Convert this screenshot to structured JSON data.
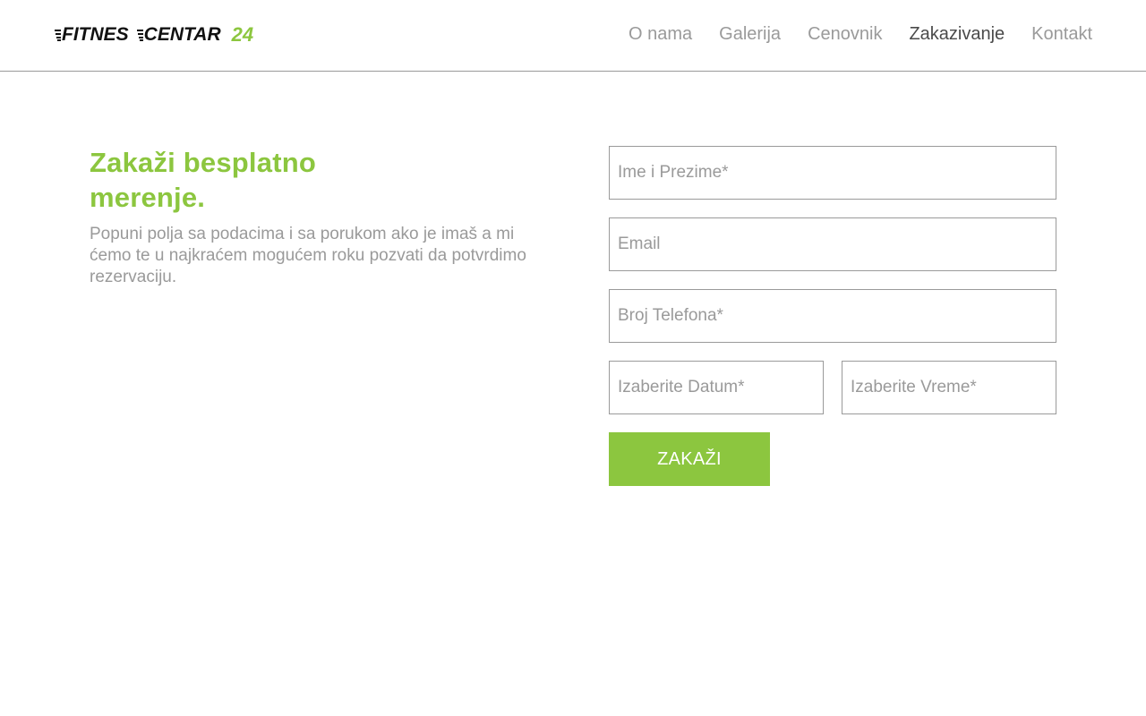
{
  "brand": {
    "word1": "FITNES",
    "word2": "CENTAR",
    "number": "24",
    "accent_color": "#8cc63f"
  },
  "nav": {
    "items": [
      {
        "label": "O nama",
        "active": false
      },
      {
        "label": "Galerija",
        "active": false
      },
      {
        "label": "Cenovnik",
        "active": false
      },
      {
        "label": "Zakazivanje",
        "active": true
      },
      {
        "label": "Kontakt",
        "active": false
      }
    ]
  },
  "intro": {
    "title": "Zakaži besplatno merenje.",
    "description": "Popuni polja sa podacima i sa porukom ako je imaš a mi ćemo te u najkraćem mogućem roku pozvati da potvrdimo rezervaciju."
  },
  "form": {
    "name": {
      "value": "",
      "placeholder": "Ime i Prezime*"
    },
    "email": {
      "value": "",
      "placeholder": "Email"
    },
    "phone": {
      "value": "",
      "placeholder": "Broj Telefona*"
    },
    "date": {
      "value": "",
      "placeholder": "Izaberite Datum*"
    },
    "time": {
      "value": "",
      "placeholder": "Izaberite Vreme*"
    },
    "submit_label": "ZAKAŽI"
  }
}
